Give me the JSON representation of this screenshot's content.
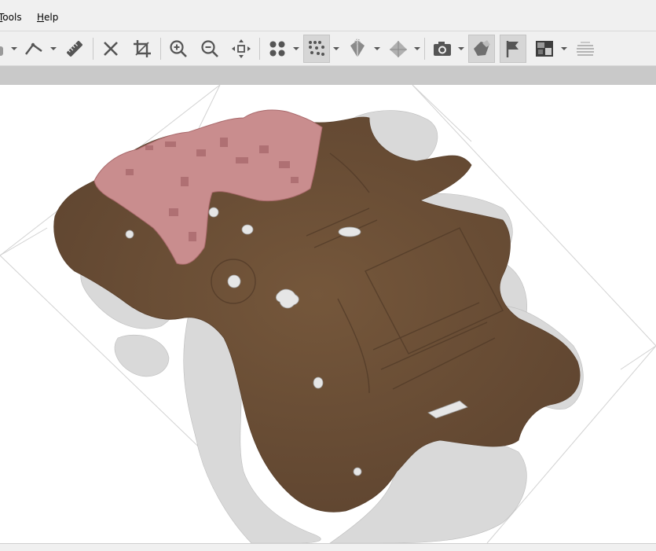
{
  "menu": {
    "items": [
      {
        "label": "Tools",
        "mnemonic": "T"
      },
      {
        "label": "Help",
        "mnemonic": "H"
      }
    ]
  },
  "toolbar": {
    "tools": [
      {
        "name": "draw-polyline",
        "icon": "polyline-icon"
      },
      {
        "name": "measure",
        "icon": "ruler-icon"
      },
      {
        "name": "delete",
        "icon": "close-icon"
      },
      {
        "name": "crop",
        "icon": "crop-icon"
      },
      {
        "name": "zoom-in",
        "icon": "zoom-in-icon"
      },
      {
        "name": "zoom-out",
        "icon": "zoom-out-icon"
      },
      {
        "name": "zoom-extents",
        "icon": "move-icon"
      },
      {
        "name": "points",
        "icon": "points-icon"
      },
      {
        "name": "dense-cloud",
        "icon": "dense-points-icon"
      },
      {
        "name": "tiled-model",
        "icon": "tiled-icon"
      },
      {
        "name": "mesh",
        "icon": "mesh-icon"
      },
      {
        "name": "cameras",
        "icon": "camera-icon"
      },
      {
        "name": "shapes",
        "icon": "shape-icon"
      },
      {
        "name": "markers",
        "icon": "flag-icon"
      },
      {
        "name": "orthomosaic",
        "icon": "ortho-icon"
      },
      {
        "name": "dem",
        "icon": "layers-icon"
      }
    ]
  },
  "colors": {
    "terrain": "#6b4e35",
    "selection": "#c98c8c",
    "noise": "#d8d8d8",
    "grid": "#cfcfcf"
  }
}
